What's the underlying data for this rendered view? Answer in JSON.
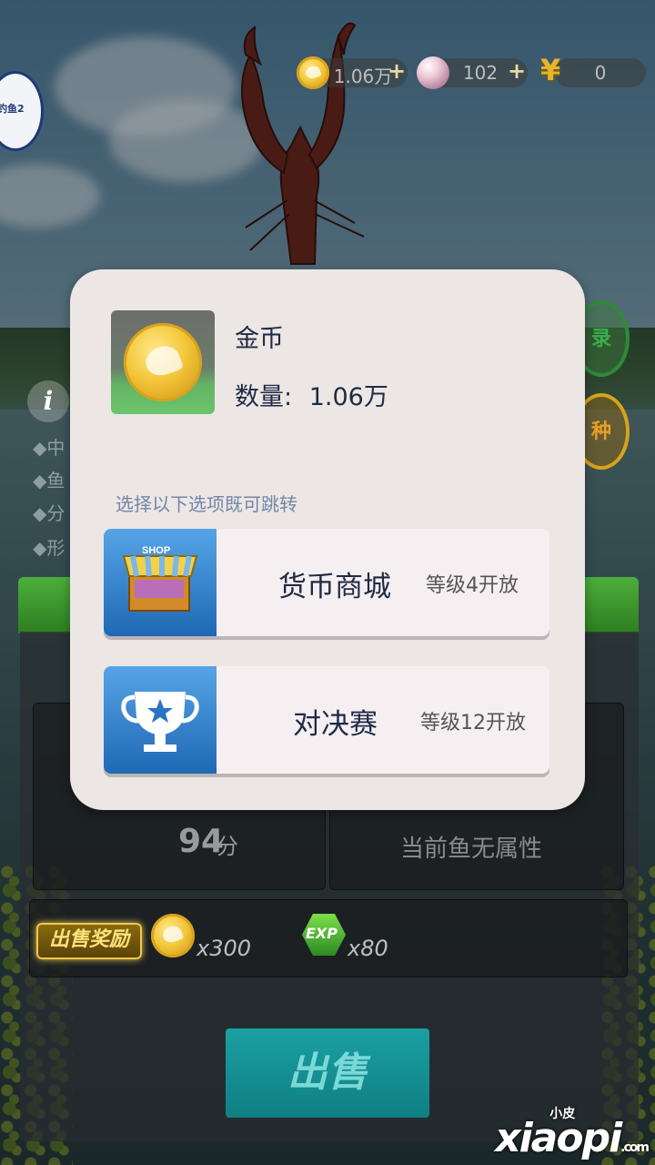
{
  "currency_bar": {
    "gold": "1.06万",
    "pearls": "102",
    "yuan": "0",
    "plus": "+"
  },
  "background_panel": {
    "score_value": "94",
    "score_unit": "分",
    "attribute_text": "当前鱼无属性",
    "reward_label": "出售奖励",
    "reward_gold": "x300",
    "reward_exp_icon_text": "EXP",
    "reward_exp": "x80",
    "sell_button": "出售",
    "side_lines": [
      "◆中",
      "◆鱼",
      "◆分",
      "◆形"
    ],
    "info_icon": "i",
    "badge_1": "录",
    "badge_2": "种"
  },
  "modal": {
    "item_name": "金币",
    "quantity_label": "数量:",
    "quantity_value": "1.06万",
    "hint": "选择以下选项既可跳转",
    "options": [
      {
        "icon": "shop-stall-icon",
        "icon_text": "SHOP",
        "label": "货币商城",
        "requirement": "等级4开放"
      },
      {
        "icon": "trophy-icon",
        "label": "对决赛",
        "requirement": "等级12开放"
      }
    ]
  },
  "watermark": {
    "text": "xiaopi",
    "small": "小皮",
    "domain": ".com"
  },
  "colors": {
    "modal_bg": "#ece6e4",
    "option_icon_bg": "#1f68b4",
    "sell_button": "#0f7f83",
    "text_dark": "#1f2a44"
  }
}
